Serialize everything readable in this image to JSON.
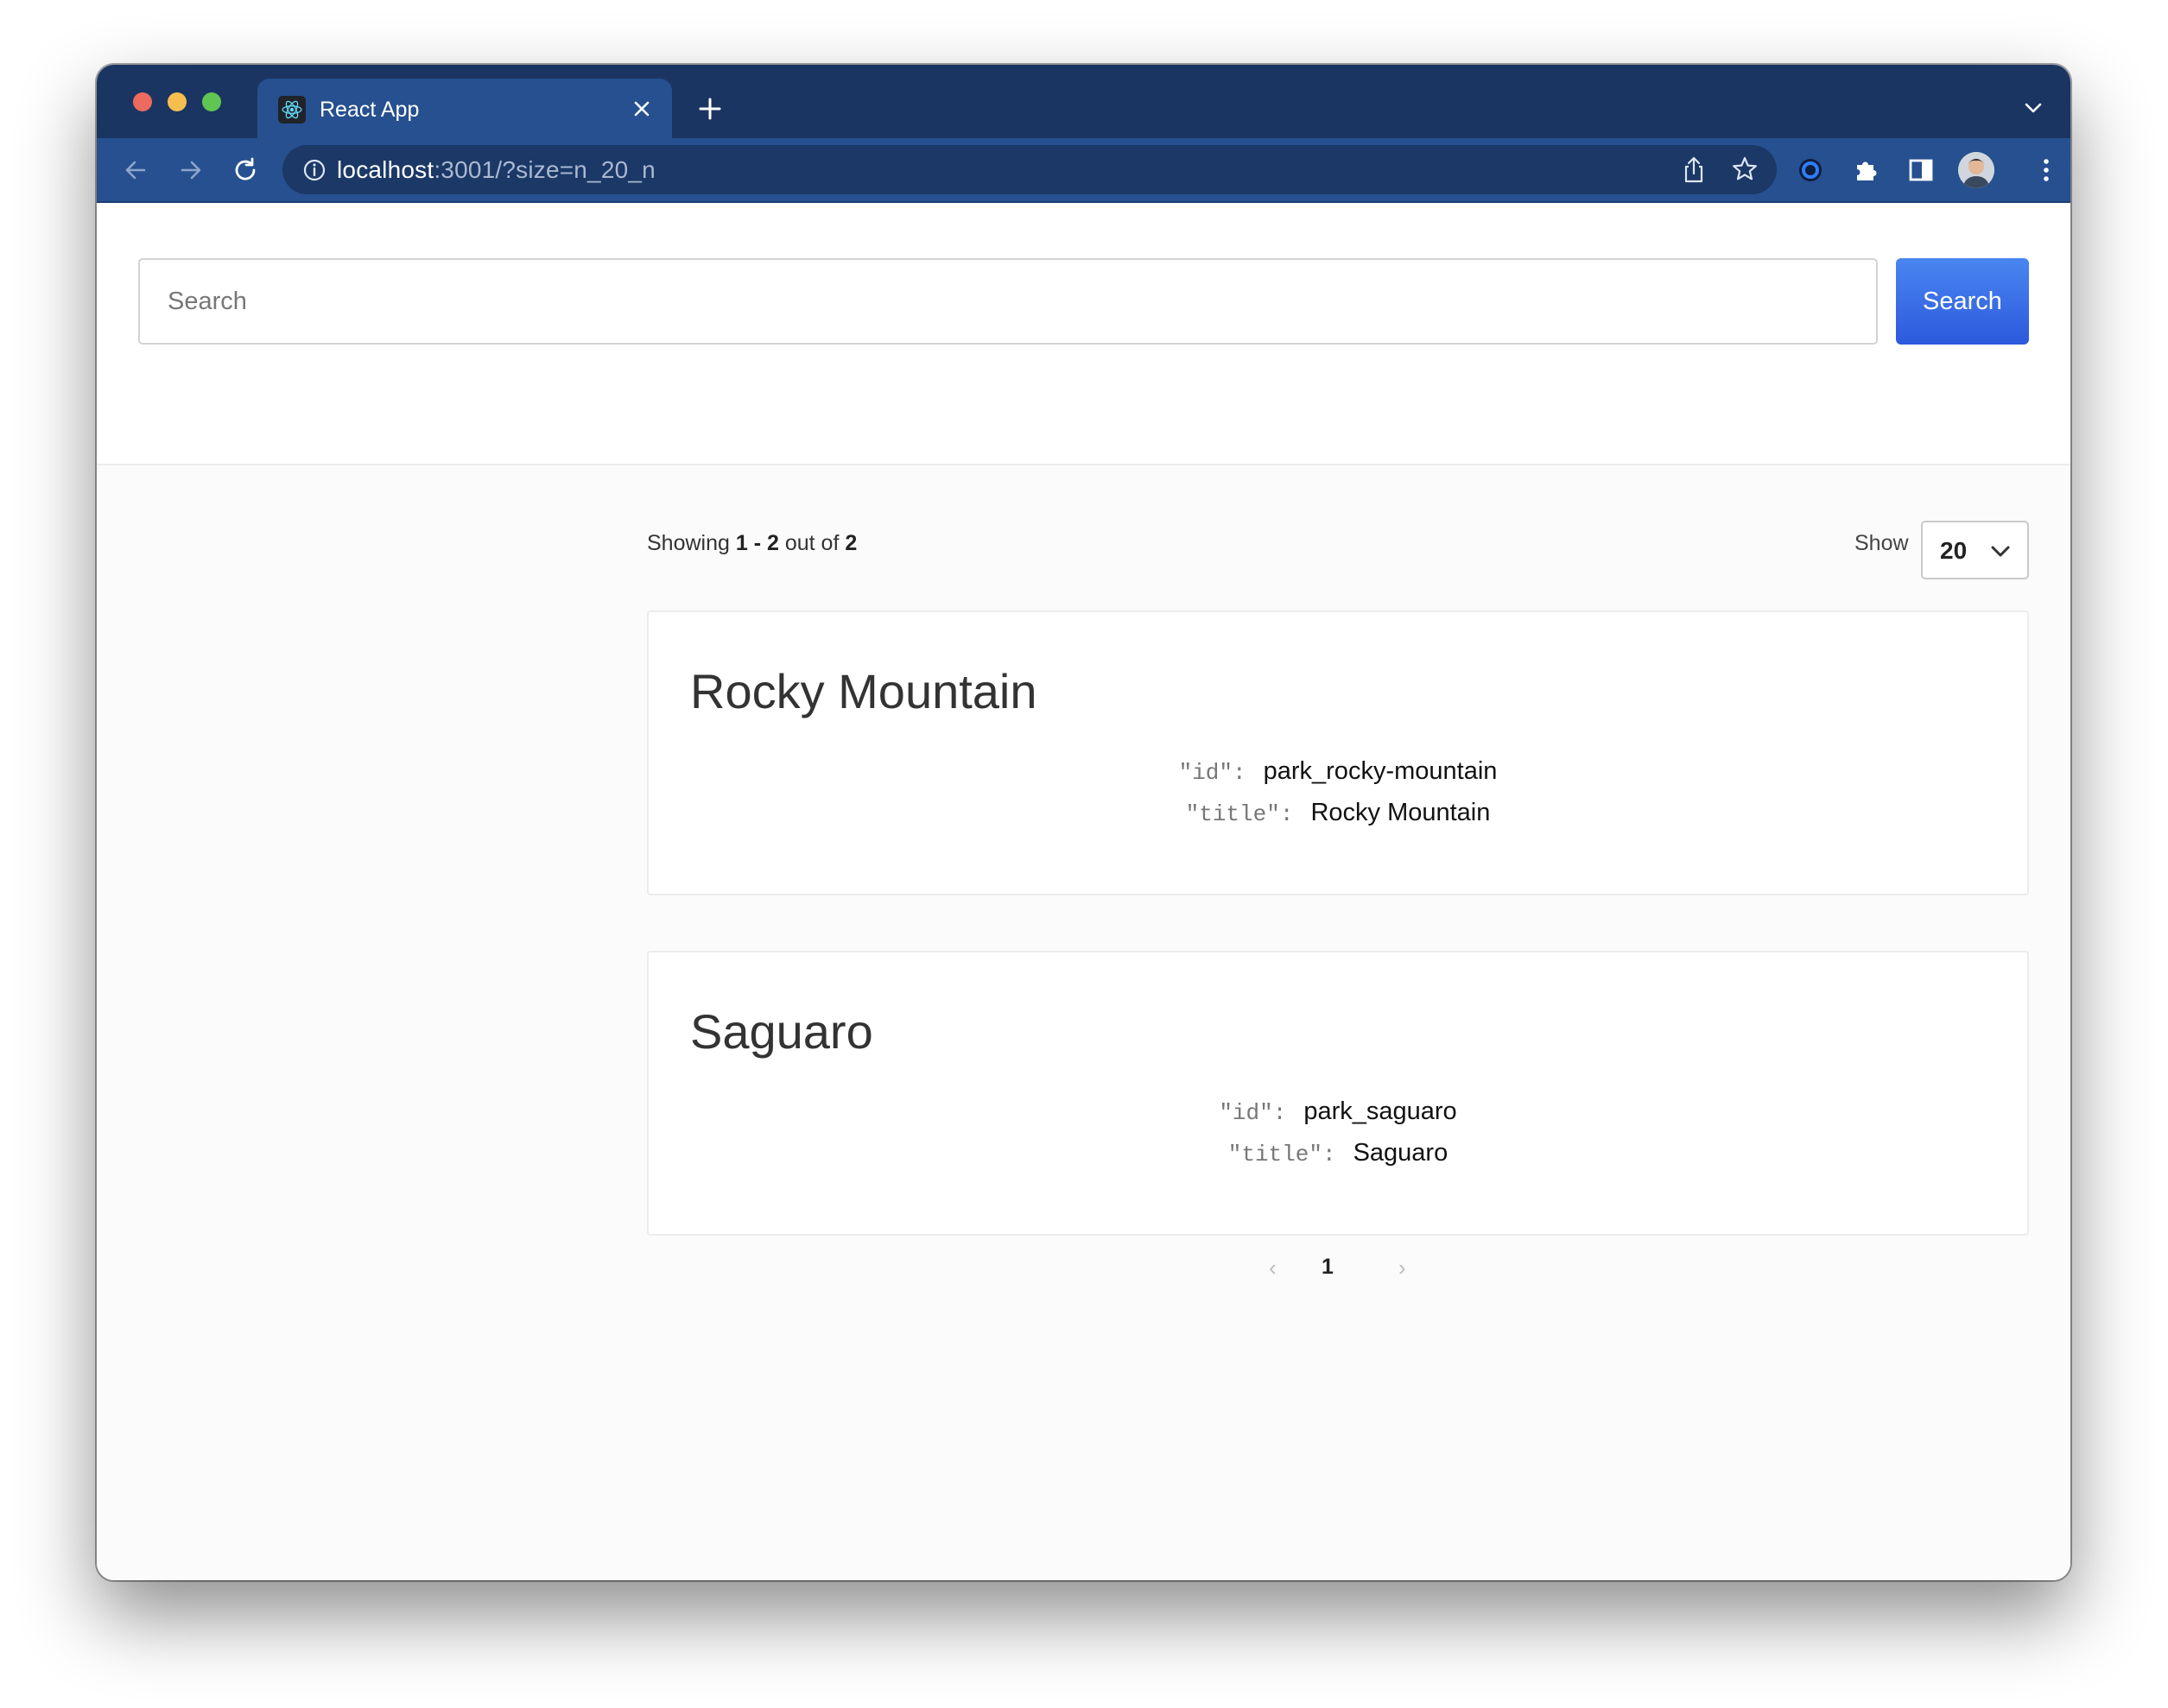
{
  "browser": {
    "tab_title": "React App",
    "url_host": "localhost",
    "url_rest": ":3001/?size=n_20_n"
  },
  "search": {
    "placeholder": "Search",
    "button_label": "Search"
  },
  "paging": {
    "showing_label": "Showing",
    "range_start": "1",
    "range_sep": " - ",
    "range_end": "2",
    "out_of_label": "out of",
    "total": "2",
    "show_label": "Show",
    "page_size": "20",
    "current_page": "1",
    "prev_symbol": "‹",
    "next_symbol": "›"
  },
  "results": [
    {
      "title": "Rocky Mountain",
      "id_key": "\"id\":",
      "id_value": "park_rocky-mountain",
      "title_key": "\"title\":",
      "title_value": "Rocky Mountain"
    },
    {
      "title": "Saguaro",
      "id_key": "\"id\":",
      "id_value": "park_saguaro",
      "title_key": "\"title\":",
      "title_value": "Saguaro"
    }
  ],
  "colors": {
    "tabstrip": "#1b3562",
    "toolbar": "#26508f",
    "search_button": "#2c59dd"
  }
}
